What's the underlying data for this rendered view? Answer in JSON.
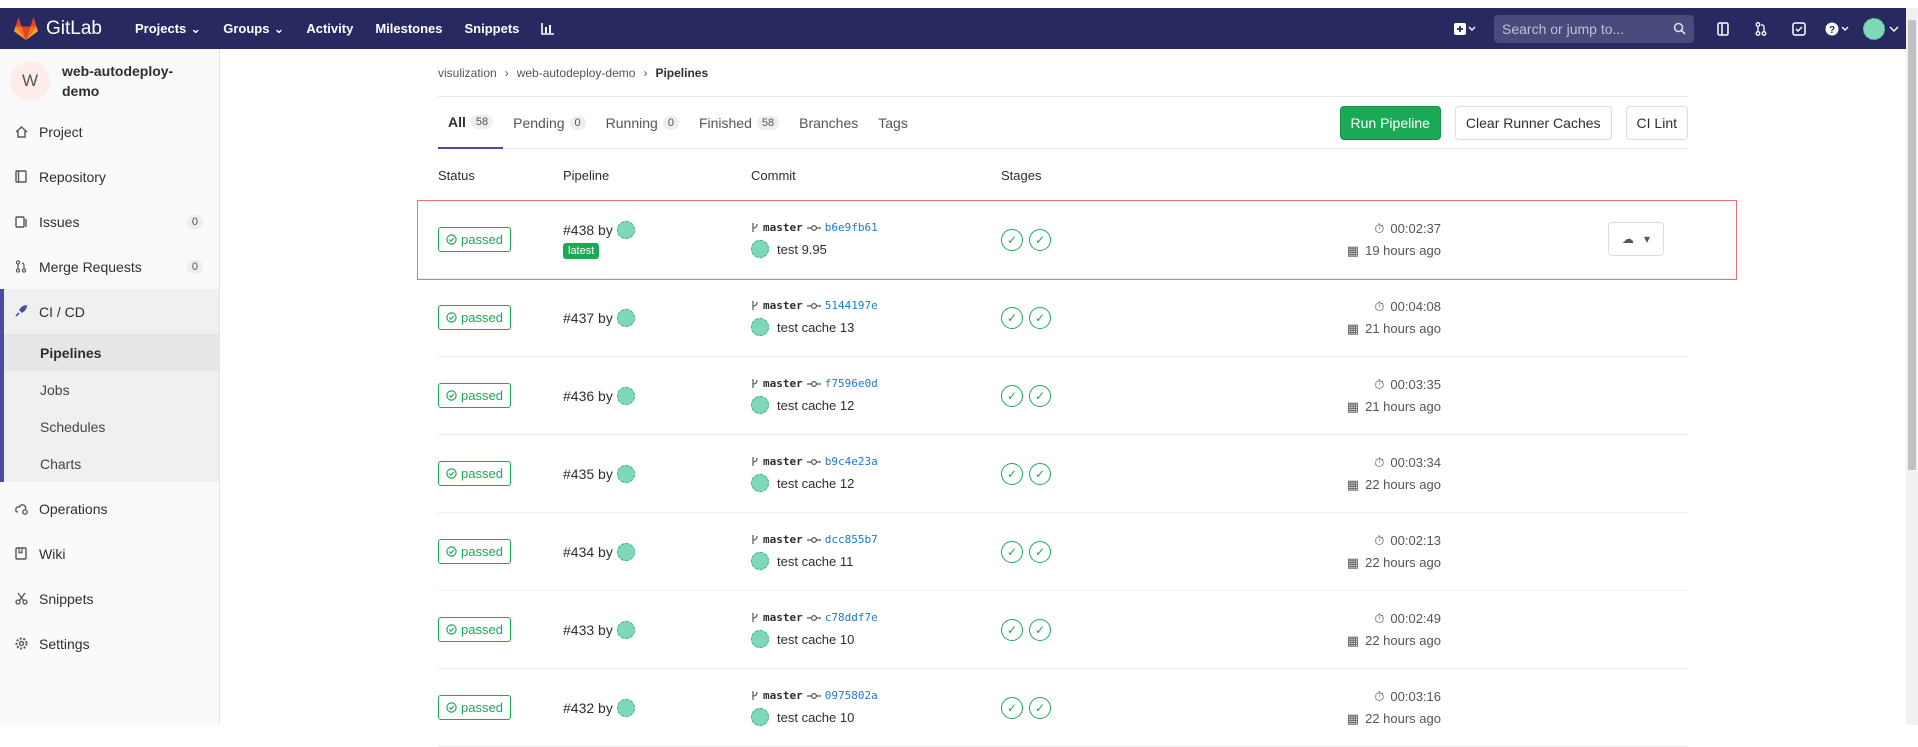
{
  "brand": {
    "name": "GitLab",
    "color": "#292961"
  },
  "topnav": {
    "projects": "Projects",
    "groups": "Groups",
    "activity": "Activity",
    "milestones": "Milestones",
    "snippets": "Snippets"
  },
  "search": {
    "placeholder": "Search or jump to..."
  },
  "project": {
    "initial": "W",
    "name": "web-autodeploy-demo"
  },
  "sidebar": {
    "items": [
      {
        "label": "Project",
        "icon": "home-icon"
      },
      {
        "label": "Repository",
        "icon": "book-icon"
      },
      {
        "label": "Issues",
        "icon": "issues-icon",
        "count": "0"
      },
      {
        "label": "Merge Requests",
        "icon": "merge-icon",
        "count": "0"
      }
    ],
    "cicd": {
      "label": "CI / CD",
      "subs": [
        "Pipelines",
        "Jobs",
        "Schedules",
        "Charts"
      ]
    },
    "lower": [
      "Operations",
      "Wiki",
      "Snippets",
      "Settings"
    ]
  },
  "breadcrumb": {
    "group": "visulization",
    "project": "web-autodeploy-demo",
    "page": "Pipelines"
  },
  "tabs": [
    {
      "label": "All",
      "count": "58"
    },
    {
      "label": "Pending",
      "count": "0"
    },
    {
      "label": "Running",
      "count": "0"
    },
    {
      "label": "Finished",
      "count": "58"
    },
    {
      "label": "Branches",
      "count": ""
    },
    {
      "label": "Tags",
      "count": ""
    }
  ],
  "buttons": {
    "run": "Run Pipeline",
    "clear": "Clear Runner Caches",
    "lint": "CI Lint"
  },
  "columns": {
    "status": "Status",
    "pipeline": "Pipeline",
    "commit": "Commit",
    "stages": "Stages"
  },
  "pipelines": [
    {
      "status": "passed",
      "id": "#438 by",
      "latest": "latest",
      "branch": "master",
      "sha": "b6e9fb61",
      "msg": "test 9.95",
      "duration": "00:02:37",
      "ago": "19 hours ago"
    },
    {
      "status": "passed",
      "id": "#437 by",
      "latest": "",
      "branch": "master",
      "sha": "5144197e",
      "msg": "test cache 13",
      "duration": "00:04:08",
      "ago": "21 hours ago"
    },
    {
      "status": "passed",
      "id": "#436 by",
      "latest": "",
      "branch": "master",
      "sha": "f7596e0d",
      "msg": "test cache 12",
      "duration": "00:03:35",
      "ago": "21 hours ago"
    },
    {
      "status": "passed",
      "id": "#435 by",
      "latest": "",
      "branch": "master",
      "sha": "b9c4e23a",
      "msg": "test cache 12",
      "duration": "00:03:34",
      "ago": "22 hours ago"
    },
    {
      "status": "passed",
      "id": "#434 by",
      "latest": "",
      "branch": "master",
      "sha": "dcc855b7",
      "msg": "test cache 11",
      "duration": "00:02:13",
      "ago": "22 hours ago"
    },
    {
      "status": "passed",
      "id": "#433 by",
      "latest": "",
      "branch": "master",
      "sha": "c78ddf7e",
      "msg": "test cache 10",
      "duration": "00:02:49",
      "ago": "22 hours ago"
    },
    {
      "status": "passed",
      "id": "#432 by",
      "latest": "",
      "branch": "master",
      "sha": "0975802a",
      "msg": "test cache 10",
      "duration": "00:03:16",
      "ago": "22 hours ago"
    }
  ]
}
